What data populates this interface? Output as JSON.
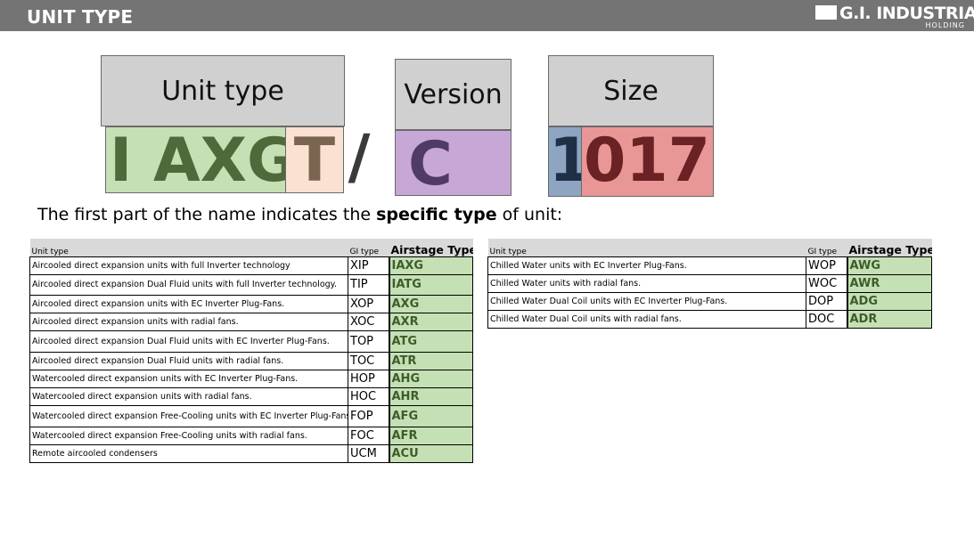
{
  "header": {
    "title": "UNIT TYPE",
    "logo_brand": "G.I. INDUSTRIAL",
    "logo_sub": "HOLDING"
  },
  "diagram": {
    "labels": {
      "unit_type": "Unit type",
      "version": "Version",
      "size": "Size"
    },
    "code": {
      "part1": "I AXG",
      "part2": "T",
      "slash": "/",
      "version": "C",
      "size_first": "1",
      "size_rest": "017"
    }
  },
  "intro": {
    "before": "The first part of the name indicates the ",
    "bold": "specific type",
    "after": " of unit:"
  },
  "colors": {
    "green": "#c5e0b4",
    "peach": "#fbe1d1",
    "purple": "#c7a7d5",
    "blue": "#8da4c2",
    "red": "#e99696"
  },
  "table_left": {
    "headers": {
      "unit": "Unit type",
      "gi": "GI type",
      "airstage": "Airstage Type"
    },
    "rows": [
      {
        "unit": "Aircooled direct expansion units with full Inverter technology",
        "gi": "XIP",
        "airstage": "IAXG"
      },
      {
        "unit": "Aircooled direct expansion Dual Fluid units with full Inverter technology.",
        "gi": "TIP",
        "airstage": "IATG"
      },
      {
        "unit": "Aircooled direct expansion units with EC Inverter Plug-Fans.",
        "gi": "XOP",
        "airstage": "AXG"
      },
      {
        "unit": "Aircooled direct expansion units with radial fans.",
        "gi": "XOC",
        "airstage": "AXR"
      },
      {
        "unit": "Aircooled direct expansion Dual Fluid units with EC Inverter Plug-Fans.",
        "gi": "TOP",
        "airstage": "ATG"
      },
      {
        "unit": "Aircooled direct expansion Dual Fluid units with radial fans.",
        "gi": "TOC",
        "airstage": "ATR"
      },
      {
        "unit": "Watercooled direct expansion units with EC Inverter Plug-Fans.",
        "gi": "HOP",
        "airstage": "AHG"
      },
      {
        "unit": "Watercooled direct expansion units with radial fans.",
        "gi": "HOC",
        "airstage": "AHR"
      },
      {
        "unit": "Watercooled direct expansion Free-Cooling units with EC Inverter Plug-Fans.",
        "gi": "FOP",
        "airstage": "AFG"
      },
      {
        "unit": "Watercooled direct expansion Free-Cooling units with radial fans.",
        "gi": "FOC",
        "airstage": "AFR"
      },
      {
        "unit": "Remote aircooled condensers",
        "gi": "UCM",
        "airstage": "ACU"
      }
    ]
  },
  "table_right": {
    "headers": {
      "unit": "Unit type",
      "gi": "GI type",
      "airstage": "Airstage Type"
    },
    "rows": [
      {
        "unit": "Chilled Water units with EC Inverter Plug-Fans.",
        "gi": "WOP",
        "airstage": "AWG"
      },
      {
        "unit": "Chilled Water units with radial fans.",
        "gi": "WOC",
        "airstage": "AWR"
      },
      {
        "unit": "Chilled Water Dual Coil units with EC Inverter Plug-Fans.",
        "gi": "DOP",
        "airstage": "ADG"
      },
      {
        "unit": "Chilled Water Dual Coil units with radial fans.",
        "gi": "DOC",
        "airstage": "ADR"
      }
    ]
  }
}
